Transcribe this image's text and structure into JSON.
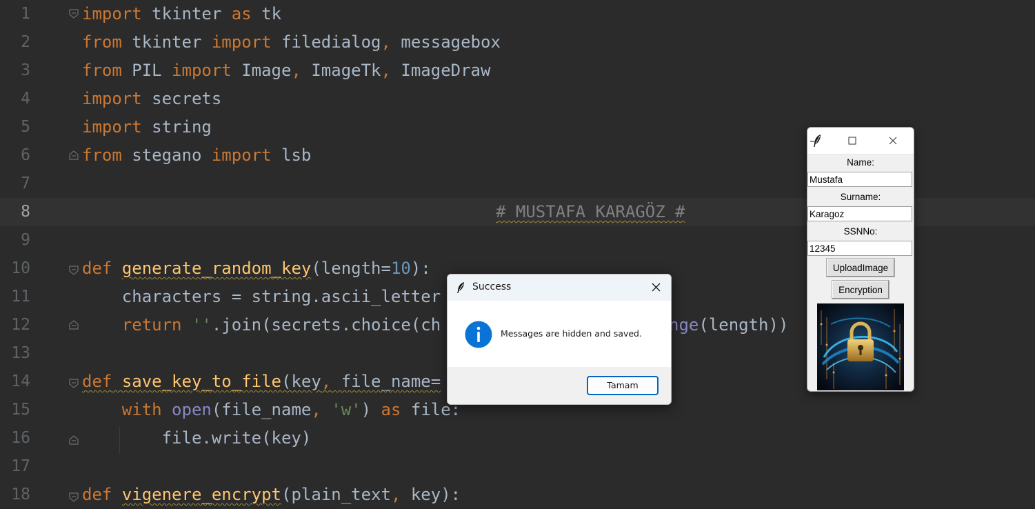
{
  "editor": {
    "lines": [
      {
        "n": "1"
      },
      {
        "n": "2"
      },
      {
        "n": "3"
      },
      {
        "n": "4"
      },
      {
        "n": "5"
      },
      {
        "n": "6"
      },
      {
        "n": "7"
      },
      {
        "n": "8"
      },
      {
        "n": "9"
      },
      {
        "n": "10"
      },
      {
        "n": "11"
      },
      {
        "n": "12"
      },
      {
        "n": "13"
      },
      {
        "n": "14"
      },
      {
        "n": "15"
      },
      {
        "n": "16"
      },
      {
        "n": "17"
      },
      {
        "n": "18"
      }
    ],
    "code": {
      "l1": [
        "import",
        " tk",
        "inter ",
        "as",
        " tk"
      ],
      "l2": [
        "from",
        " tkinter ",
        "import",
        " filedialog",
        ",",
        " messagebox"
      ],
      "l3": [
        "from",
        " PIL ",
        "import",
        " Image",
        ",",
        " ImageTk",
        ",",
        " ImageDraw"
      ],
      "l4": [
        "import",
        " secrets"
      ],
      "l5": [
        "import",
        " string"
      ],
      "l6": [
        "from",
        " stegano ",
        "import",
        " lsb"
      ],
      "l8": "# MUSTAFA KARAGÖZ #",
      "l10": [
        "def",
        " ",
        "generate_random_key",
        "(length=",
        "10",
        "):"
      ],
      "l11": "    characters = string.ascii_letter",
      "l12": [
        "    ",
        "return",
        " ",
        "''",
        ".join(secrets.choice(ch",
        "nge",
        "(length))"
      ],
      "l14": [
        "def",
        " ",
        "save_key_to_file",
        "(key",
        ",",
        " file_name="
      ],
      "l15": [
        "    ",
        "with",
        " ",
        "open",
        "(file_name",
        ",",
        " ",
        "'w'",
        ") ",
        "as",
        " file:"
      ],
      "l16": "        file.write(key)",
      "l18": [
        "def",
        " ",
        "vigenere_encrypt",
        "(plain_text",
        ",",
        " key):"
      ]
    }
  },
  "msgbox": {
    "title": "Success",
    "message": "Messages are hidden and saved.",
    "ok_label": "Tamam"
  },
  "tkapp": {
    "name_label": "Name:",
    "name_value": "Mustafa",
    "surname_label": "Surname:",
    "surname_value": "Karagoz",
    "ssn_label": "SSNNo:",
    "ssn_value": "12345",
    "upload_label": "UploadImage",
    "encrypt_label": "Encryption"
  },
  "colors": {
    "editor_bg": "#2b2b2b",
    "keyword": "#cc7832",
    "function": "#ffc66d",
    "number": "#6897bb",
    "string": "#6a8759",
    "builtin": "#8888c6",
    "comment": "#808080",
    "accent": "#0067c0"
  }
}
